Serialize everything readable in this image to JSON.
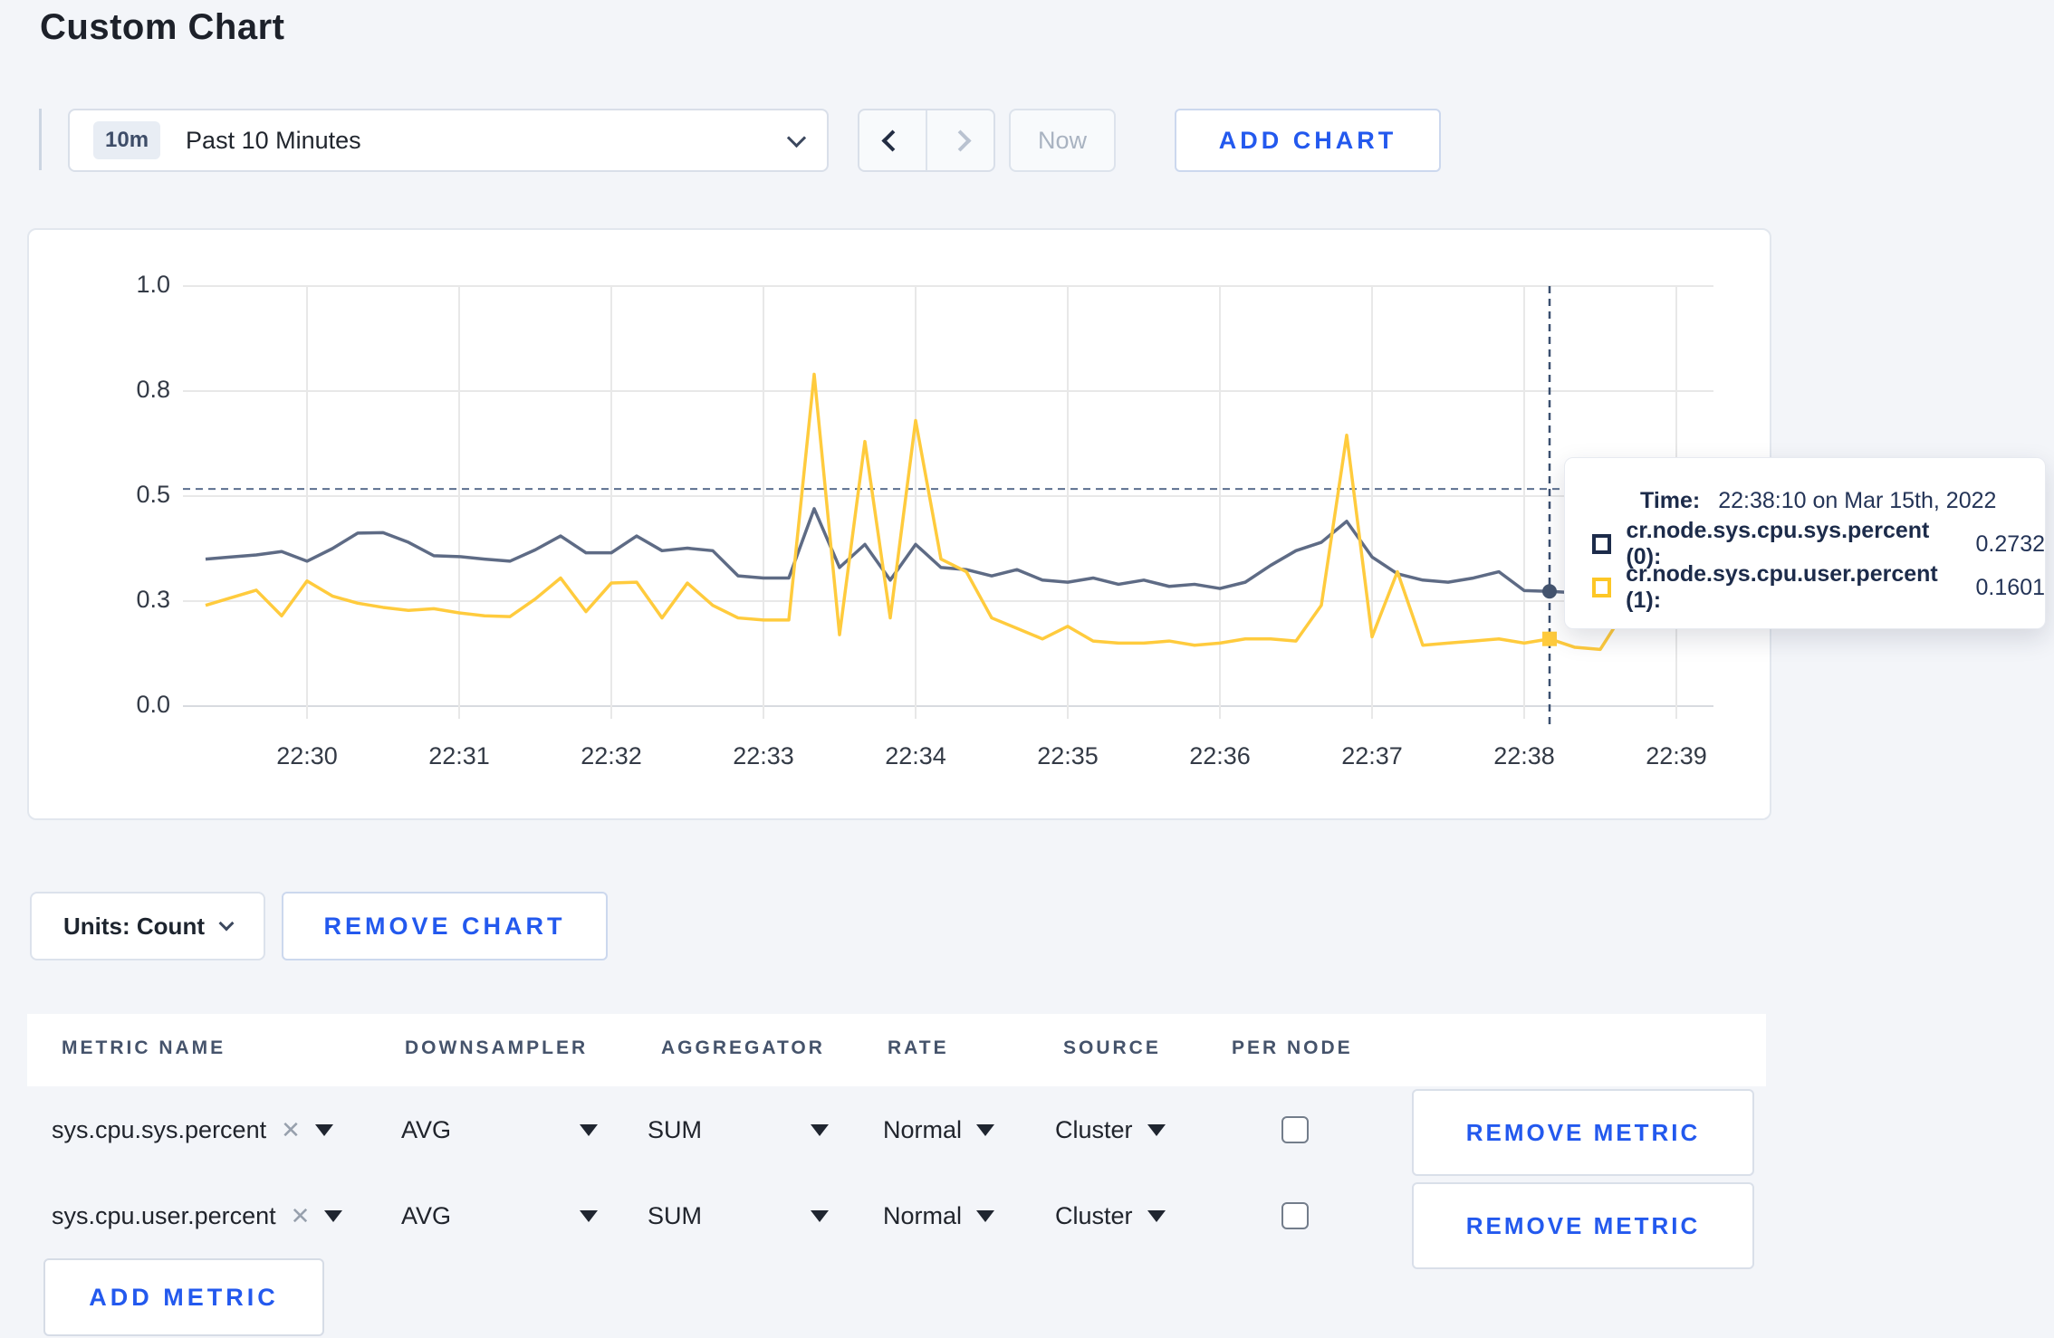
{
  "page": {
    "title": "Custom Chart",
    "background": "#f3f5f9",
    "accent_blue": "#2359ee"
  },
  "toolbar": {
    "time_range_badge": "10m",
    "time_range_label": "Past 10 Minutes",
    "now_label": "Now",
    "add_chart_label": "ADD CHART"
  },
  "icons": {
    "time_range": "chevron-down-icon",
    "pager_prev": "chevron-left-icon",
    "pager_next": "chevron-right-icon",
    "units": "chevron-down-icon",
    "metric_remove": "x-icon",
    "select_caret": "caret-down-icon"
  },
  "chart_data": {
    "type": "line",
    "title": "",
    "xlabel": "",
    "ylabel": "",
    "x_start": "22:29:20",
    "x_interval_seconds": 10,
    "ylim": [
      0,
      1.0
    ],
    "grid": true,
    "y_gridline_values": [
      0,
      0.25,
      0.5,
      0.75,
      1.0
    ],
    "y_tick_labels": [
      "0.0",
      "0.3",
      "0.5",
      "0.8",
      "1.0"
    ],
    "x_tick_labels": [
      "22:30",
      "22:31",
      "22:32",
      "22:33",
      "22:34",
      "22:35",
      "22:36",
      "22:37",
      "22:38",
      "22:39"
    ],
    "series": [
      {
        "name": "cr.node.sys.cpu.sys.percent (0)",
        "color": "#5e6b85",
        "marker": "circle",
        "values": [
          0.35,
          0.355,
          0.36,
          0.368,
          0.345,
          0.375,
          0.412,
          0.413,
          0.39,
          0.358,
          0.356,
          0.35,
          0.345,
          0.372,
          0.405,
          0.365,
          0.365,
          0.405,
          0.37,
          0.376,
          0.37,
          0.31,
          0.305,
          0.305,
          0.47,
          0.33,
          0.385,
          0.3,
          0.385,
          0.33,
          0.325,
          0.31,
          0.325,
          0.3,
          0.295,
          0.305,
          0.29,
          0.3,
          0.285,
          0.29,
          0.28,
          0.295,
          0.335,
          0.37,
          0.39,
          0.44,
          0.355,
          0.315,
          0.3,
          0.295,
          0.305,
          0.32,
          0.275,
          0.2732,
          0.27,
          0.275,
          0.29,
          0.3,
          0.305,
          0.3
        ]
      },
      {
        "name": "cr.node.sys.cpu.user.percent (1)",
        "color": "#ffcb3d",
        "marker": "square",
        "values": [
          0.24,
          0.258,
          0.276,
          0.215,
          0.298,
          0.262,
          0.245,
          0.235,
          0.228,
          0.232,
          0.222,
          0.215,
          0.213,
          0.255,
          0.305,
          0.225,
          0.293,
          0.295,
          0.21,
          0.293,
          0.24,
          0.21,
          0.205,
          0.205,
          0.79,
          0.17,
          0.63,
          0.21,
          0.68,
          0.35,
          0.32,
          0.21,
          0.185,
          0.16,
          0.19,
          0.155,
          0.15,
          0.15,
          0.155,
          0.145,
          0.15,
          0.16,
          0.16,
          0.155,
          0.24,
          0.645,
          0.165,
          0.32,
          0.145,
          0.15,
          0.155,
          0.16,
          0.15,
          0.1601,
          0.14,
          0.135,
          0.23,
          0.38,
          0.38,
          0.27
        ]
      }
    ],
    "crosshair": {
      "index": 53,
      "time": "22:38:10",
      "horizontal_value": 0.517,
      "color": "#3b5070"
    },
    "legend_position": "tooltip"
  },
  "tooltip": {
    "time_label": "Time:",
    "time_value": "22:38:10 on Mar 15th, 2022",
    "rows": [
      {
        "label": "cr.node.sys.cpu.sys.percent (0):",
        "value": "0.2732",
        "swatch_color": "#1c2b4a"
      },
      {
        "label": "cr.node.sys.cpu.user.percent (1):",
        "value": "0.1601",
        "swatch_color": "#fdc726"
      }
    ]
  },
  "chart_footer": {
    "units_label": "Units: Count",
    "remove_chart_label": "REMOVE CHART"
  },
  "metrics_table": {
    "headers": [
      "METRIC NAME",
      "DOWNSAMPLER",
      "AGGREGATOR",
      "RATE",
      "SOURCE",
      "PER NODE"
    ],
    "rows": [
      {
        "metric_name": "sys.cpu.sys.percent",
        "downsampler": "AVG",
        "aggregator": "SUM",
        "rate": "Normal",
        "source": "Cluster",
        "per_node_checked": false,
        "remove_label": "REMOVE METRIC"
      },
      {
        "metric_name": "sys.cpu.user.percent",
        "downsampler": "AVG",
        "aggregator": "SUM",
        "rate": "Normal",
        "source": "Cluster",
        "per_node_checked": false,
        "remove_label": "REMOVE METRIC"
      }
    ],
    "add_metric_label": "ADD METRIC"
  }
}
